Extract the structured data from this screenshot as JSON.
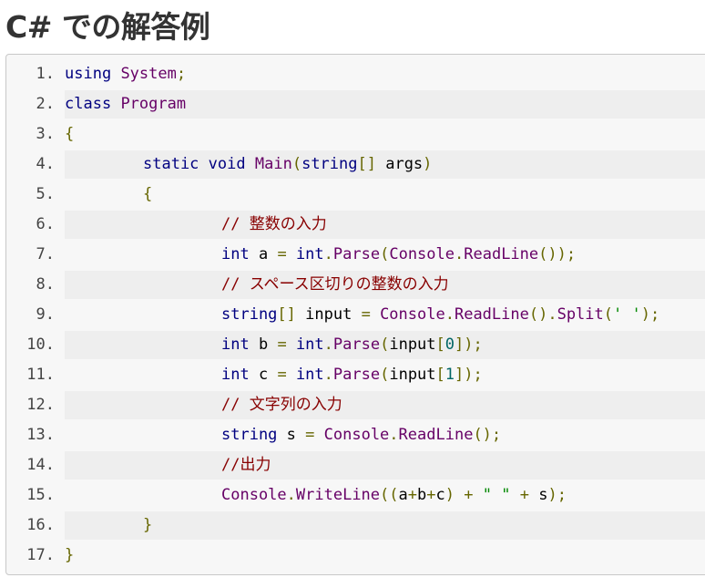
{
  "title": "C# での解答例",
  "code_lines": [
    {
      "num": "1.",
      "indent": 0,
      "tokens": [
        {
          "t": "using",
          "c": "kw"
        },
        {
          "t": " ",
          "c": "pl"
        },
        {
          "t": "System",
          "c": "tp"
        },
        {
          "t": ";",
          "c": "pn"
        }
      ]
    },
    {
      "num": "2.",
      "indent": 0,
      "tokens": [
        {
          "t": "class",
          "c": "kw"
        },
        {
          "t": " ",
          "c": "pl"
        },
        {
          "t": "Program",
          "c": "tp"
        }
      ]
    },
    {
      "num": "3.",
      "indent": 0,
      "tokens": [
        {
          "t": "{",
          "c": "pn"
        }
      ]
    },
    {
      "num": "4.",
      "indent": 1,
      "tokens": [
        {
          "t": "static",
          "c": "kw"
        },
        {
          "t": " ",
          "c": "pl"
        },
        {
          "t": "void",
          "c": "kw"
        },
        {
          "t": " ",
          "c": "pl"
        },
        {
          "t": "Main",
          "c": "tp"
        },
        {
          "t": "(",
          "c": "pn"
        },
        {
          "t": "string",
          "c": "kw"
        },
        {
          "t": "[]",
          "c": "pn"
        },
        {
          "t": " args",
          "c": "pl"
        },
        {
          "t": ")",
          "c": "pn"
        }
      ]
    },
    {
      "num": "5.",
      "indent": 1,
      "tokens": [
        {
          "t": "{",
          "c": "pn"
        }
      ]
    },
    {
      "num": "6.",
      "indent": 2,
      "tokens": [
        {
          "t": "// 整数の入力",
          "c": "cm"
        }
      ]
    },
    {
      "num": "7.",
      "indent": 2,
      "tokens": [
        {
          "t": "int",
          "c": "kw"
        },
        {
          "t": " a ",
          "c": "pl"
        },
        {
          "t": "=",
          "c": "pn"
        },
        {
          "t": " ",
          "c": "pl"
        },
        {
          "t": "int",
          "c": "kw"
        },
        {
          "t": ".",
          "c": "pn"
        },
        {
          "t": "Parse",
          "c": "tp"
        },
        {
          "t": "(",
          "c": "pn"
        },
        {
          "t": "Console",
          "c": "tp"
        },
        {
          "t": ".",
          "c": "pn"
        },
        {
          "t": "ReadLine",
          "c": "tp"
        },
        {
          "t": "());",
          "c": "pn"
        }
      ]
    },
    {
      "num": "8.",
      "indent": 2,
      "tokens": [
        {
          "t": "// スペース区切りの整数の入力",
          "c": "cm"
        }
      ]
    },
    {
      "num": "9.",
      "indent": 2,
      "tokens": [
        {
          "t": "string",
          "c": "kw"
        },
        {
          "t": "[]",
          "c": "pn"
        },
        {
          "t": " input ",
          "c": "pl"
        },
        {
          "t": "=",
          "c": "pn"
        },
        {
          "t": " ",
          "c": "pl"
        },
        {
          "t": "Console",
          "c": "tp"
        },
        {
          "t": ".",
          "c": "pn"
        },
        {
          "t": "ReadLine",
          "c": "tp"
        },
        {
          "t": "().",
          "c": "pn"
        },
        {
          "t": "Split",
          "c": "tp"
        },
        {
          "t": "(",
          "c": "pn"
        },
        {
          "t": "' '",
          "c": "st"
        },
        {
          "t": ");",
          "c": "pn"
        }
      ]
    },
    {
      "num": "10.",
      "indent": 2,
      "tokens": [
        {
          "t": "int",
          "c": "kw"
        },
        {
          "t": " b ",
          "c": "pl"
        },
        {
          "t": "=",
          "c": "pn"
        },
        {
          "t": " ",
          "c": "pl"
        },
        {
          "t": "int",
          "c": "kw"
        },
        {
          "t": ".",
          "c": "pn"
        },
        {
          "t": "Parse",
          "c": "tp"
        },
        {
          "t": "(",
          "c": "pn"
        },
        {
          "t": "input",
          "c": "pl"
        },
        {
          "t": "[",
          "c": "pn"
        },
        {
          "t": "0",
          "c": "lit"
        },
        {
          "t": "]);",
          "c": "pn"
        }
      ]
    },
    {
      "num": "11.",
      "indent": 2,
      "tokens": [
        {
          "t": "int",
          "c": "kw"
        },
        {
          "t": " c ",
          "c": "pl"
        },
        {
          "t": "=",
          "c": "pn"
        },
        {
          "t": " ",
          "c": "pl"
        },
        {
          "t": "int",
          "c": "kw"
        },
        {
          "t": ".",
          "c": "pn"
        },
        {
          "t": "Parse",
          "c": "tp"
        },
        {
          "t": "(",
          "c": "pn"
        },
        {
          "t": "input",
          "c": "pl"
        },
        {
          "t": "[",
          "c": "pn"
        },
        {
          "t": "1",
          "c": "lit"
        },
        {
          "t": "]);",
          "c": "pn"
        }
      ]
    },
    {
      "num": "12.",
      "indent": 2,
      "tokens": [
        {
          "t": "// 文字列の入力",
          "c": "cm"
        }
      ]
    },
    {
      "num": "13.",
      "indent": 2,
      "tokens": [
        {
          "t": "string",
          "c": "kw"
        },
        {
          "t": " s ",
          "c": "pl"
        },
        {
          "t": "=",
          "c": "pn"
        },
        {
          "t": " ",
          "c": "pl"
        },
        {
          "t": "Console",
          "c": "tp"
        },
        {
          "t": ".",
          "c": "pn"
        },
        {
          "t": "ReadLine",
          "c": "tp"
        },
        {
          "t": "();",
          "c": "pn"
        }
      ]
    },
    {
      "num": "14.",
      "indent": 2,
      "tokens": [
        {
          "t": "//出力",
          "c": "cm"
        }
      ]
    },
    {
      "num": "15.",
      "indent": 2,
      "tokens": [
        {
          "t": "Console",
          "c": "tp"
        },
        {
          "t": ".",
          "c": "pn"
        },
        {
          "t": "WriteLine",
          "c": "tp"
        },
        {
          "t": "((",
          "c": "pn"
        },
        {
          "t": "a",
          "c": "pl"
        },
        {
          "t": "+",
          "c": "pn"
        },
        {
          "t": "b",
          "c": "pl"
        },
        {
          "t": "+",
          "c": "pn"
        },
        {
          "t": "c",
          "c": "pl"
        },
        {
          "t": ")",
          "c": "pn"
        },
        {
          "t": " ",
          "c": "pl"
        },
        {
          "t": "+",
          "c": "pn"
        },
        {
          "t": " ",
          "c": "pl"
        },
        {
          "t": "\" \"",
          "c": "st"
        },
        {
          "t": " ",
          "c": "pl"
        },
        {
          "t": "+",
          "c": "pn"
        },
        {
          "t": " s",
          "c": "pl"
        },
        {
          "t": ");",
          "c": "pn"
        }
      ]
    },
    {
      "num": "16.",
      "indent": 1,
      "tokens": [
        {
          "t": "}",
          "c": "pn"
        }
      ]
    },
    {
      "num": "17.",
      "indent": 0,
      "tokens": [
        {
          "t": "}",
          "c": "pn"
        }
      ]
    }
  ]
}
